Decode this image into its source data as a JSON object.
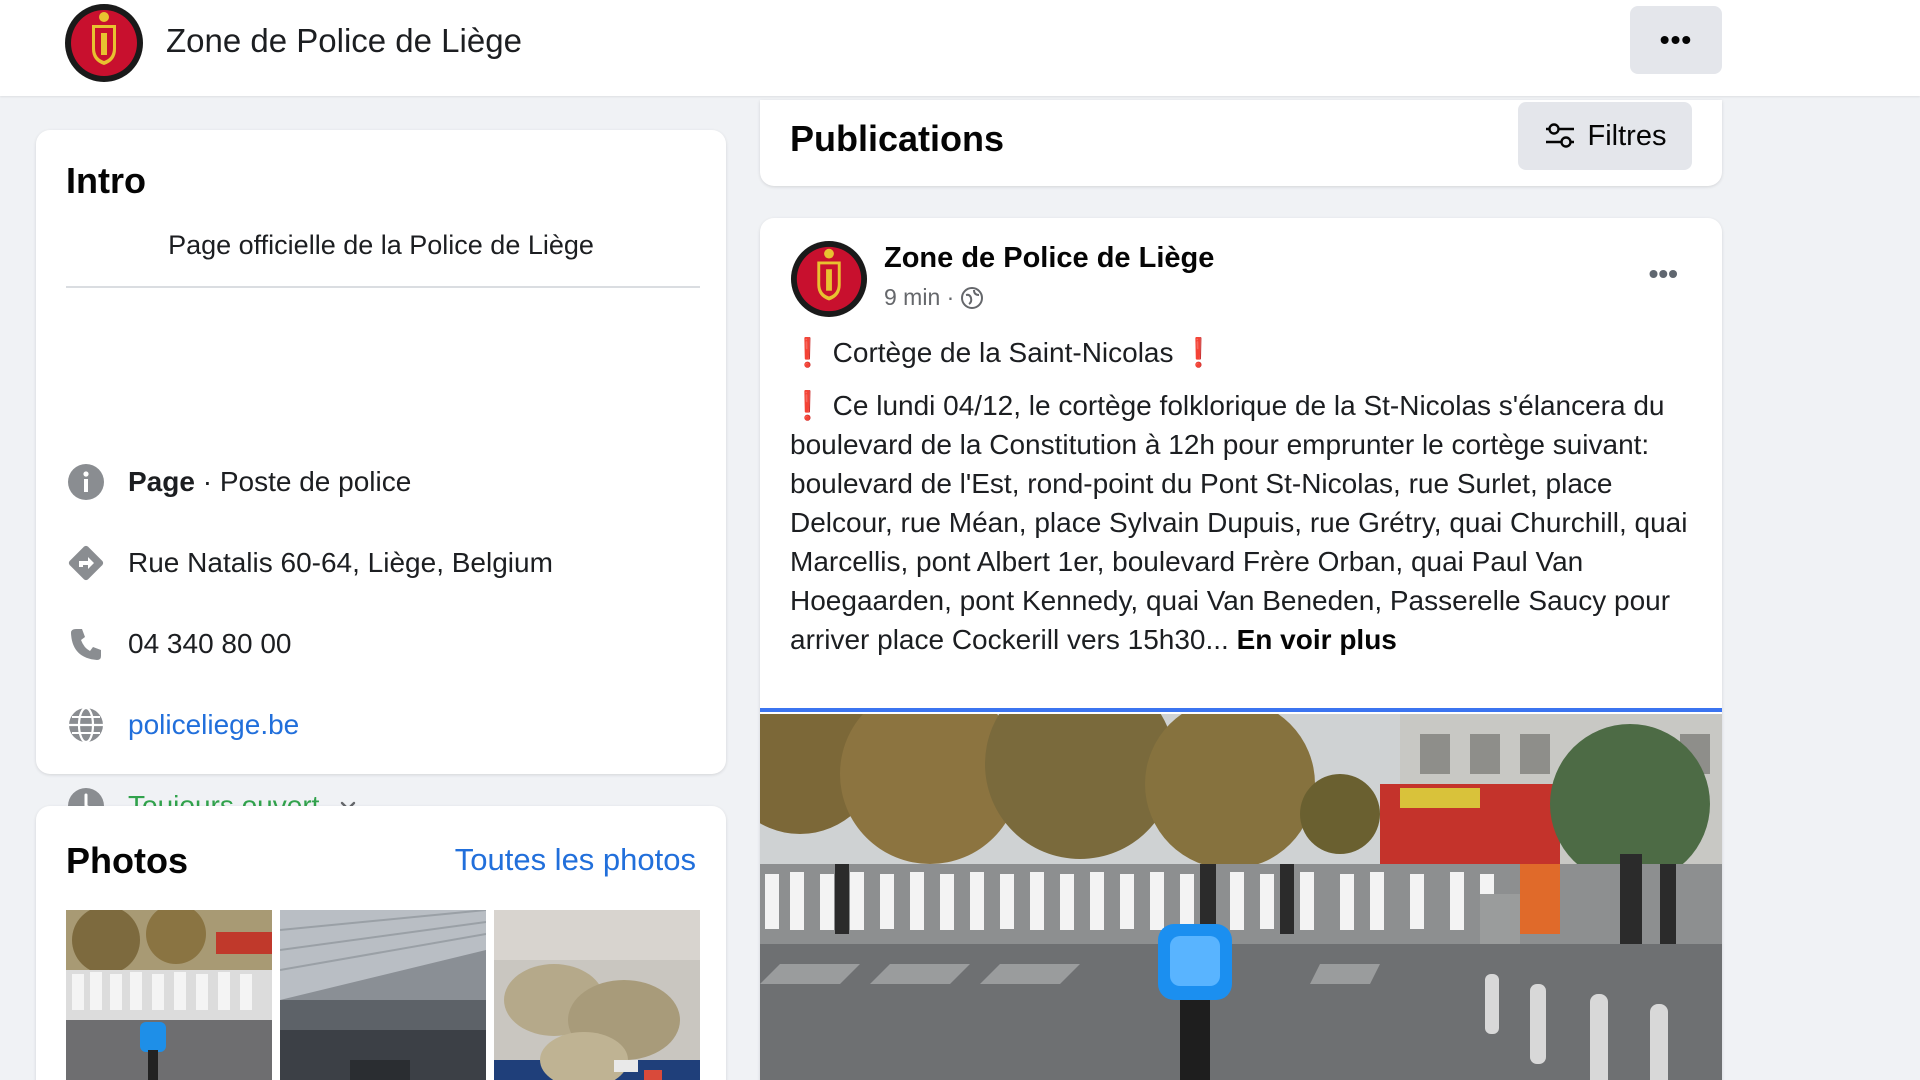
{
  "header": {
    "page_name": "Zone de Police de Liège",
    "more_label": "•••"
  },
  "intro": {
    "title": "Intro",
    "bio": "Page officielle de la Police de Liège",
    "category_bold": "Page",
    "category_rest": " · Poste de police",
    "address": "Rue Natalis 60-64, Liège, Belgium",
    "phone": "04 340 80 00",
    "website": "policeliege.be",
    "hours": "Toujours ouvert"
  },
  "photos": {
    "title": "Photos",
    "see_all": "Toutes les photos"
  },
  "publications": {
    "title": "Publications",
    "filter_label": "Filtres"
  },
  "post": {
    "author": "Zone de Police de Liège",
    "time": "9 min ·",
    "title_mark": "❗",
    "title_text": " Cortège de la Saint-Nicolas ",
    "body_mark": "❗",
    "body_text": " Ce lundi 04/12, le cortège folklorique de la St-Nicolas s'élancera du boulevard de la Constitution à 12h pour emprunter le cortège suivant: boulevard de l'Est, rond-point du Pont St-Nicolas, rue Surlet, place Delcour, rue Méan, place Sylvain Dupuis, rue Grétry, quai Churchill, quai Marcellis, pont Albert 1er, boulevard Frère Orban, quai Paul Van Hoegaarden, pont Kennedy, quai Van Beneden, Passerelle Saucy pour arriver place Cockerill vers 15h30... ",
    "see_more": "En voir plus",
    "more_label": "•••"
  },
  "icons": {
    "info": "info-icon",
    "address": "directions-icon",
    "phone": "phone-icon",
    "website": "globe-icon",
    "hours": "clock-icon",
    "filter": "sliders-icon",
    "audience": "globe-icon"
  },
  "colors": {
    "link": "#216fdb",
    "open": "#31a24c",
    "bg": "#f0f2f5",
    "alert": "#e02424",
    "accent_bar": "#3b74f0"
  }
}
